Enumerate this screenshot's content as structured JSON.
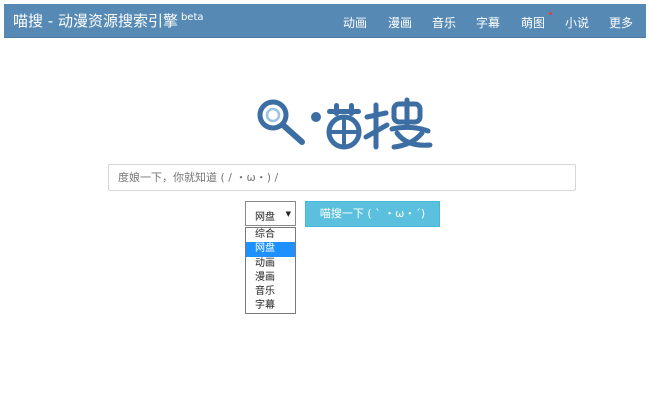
{
  "header": {
    "brand": "喵搜 - 动漫资源搜索引擎",
    "beta": "beta",
    "nav": [
      "动画",
      "漫画",
      "音乐",
      "字幕",
      "萌图",
      "小说",
      "更多"
    ]
  },
  "logo": {
    "text": "喵搜",
    "icon": "magnifier-icon"
  },
  "search": {
    "placeholder": "度娘一下，你就知道 ( / ・ω・) /"
  },
  "category": {
    "selected": "网盘",
    "options": [
      "综合",
      "网盘",
      "动画",
      "漫画",
      "音乐",
      "字幕"
    ]
  },
  "button": {
    "label": "喵搜一下 ( ` ・ω・´)"
  },
  "colors": {
    "navbar": "#5689b4",
    "button": "#5bc0de",
    "selected_option": "#1e90ff",
    "logo": "#3d6ea3"
  }
}
